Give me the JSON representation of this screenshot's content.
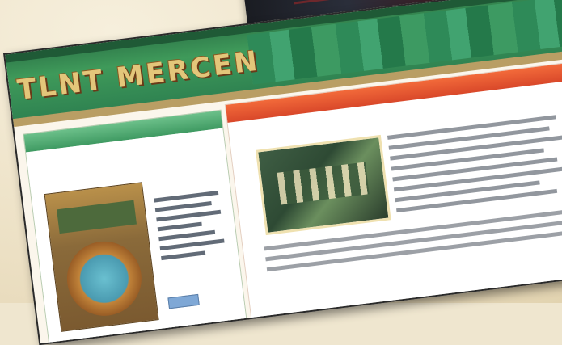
{
  "site": {
    "logo_text": "TLNT MERCEN",
    "sidebar_panel_title": "",
    "main_tab_label": "",
    "article_heading": ""
  },
  "icons": {
    "book_cover": "book-cover-image",
    "article_photo": "article-photo-image"
  },
  "colors": {
    "header_green": "#2f7a4a",
    "logo_gold": "#e3c67a",
    "sidebar_green": "#6cc08a",
    "tab_orange": "#f26a3a",
    "title_red": "#c0364a",
    "paper_background": "#efe6cf"
  }
}
